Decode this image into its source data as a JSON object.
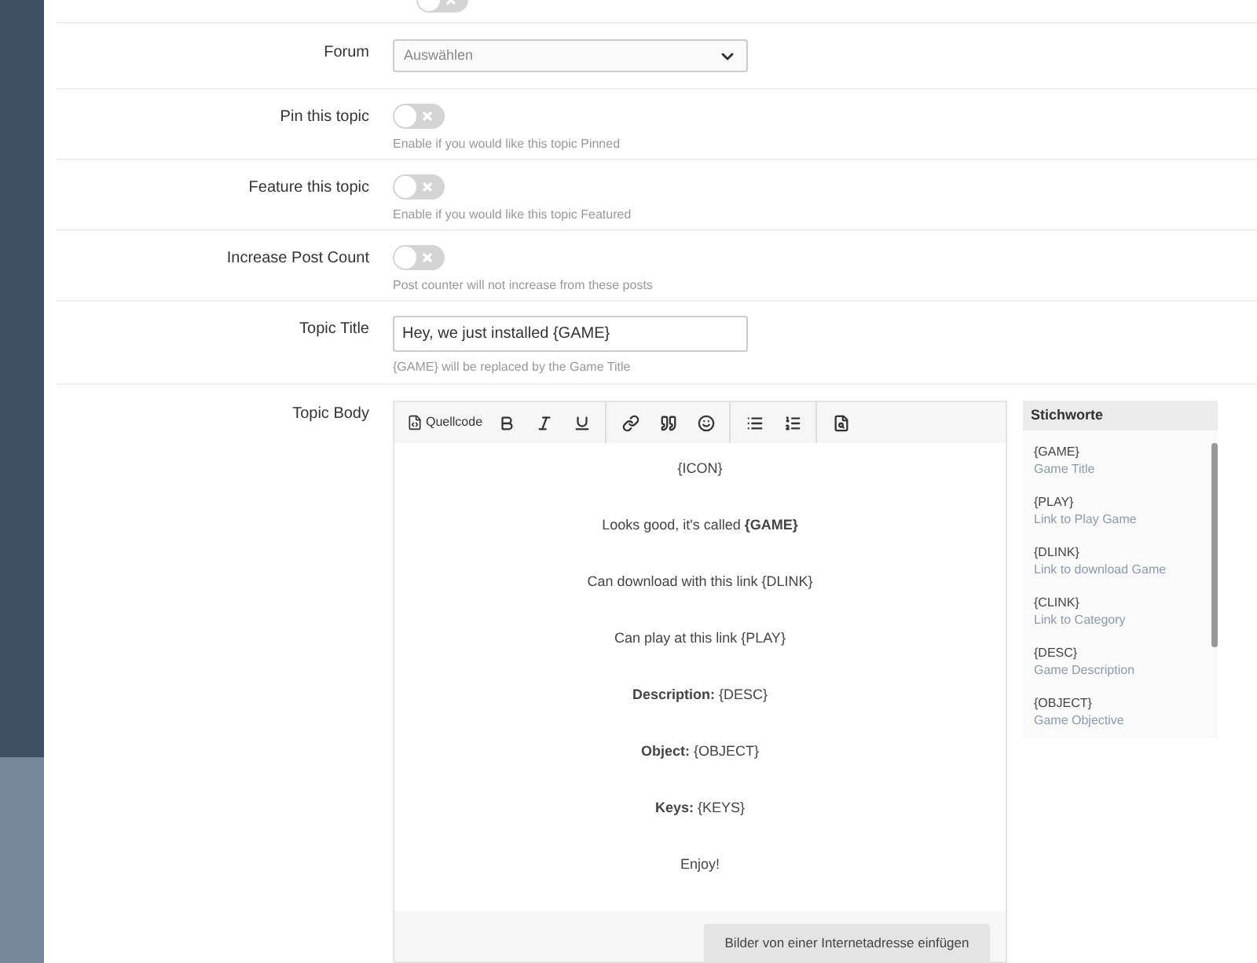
{
  "top_toggle": {
    "on": false
  },
  "rows": [
    {
      "kind": "select",
      "label": "Forum",
      "placeholder": "Auswählen"
    },
    {
      "kind": "toggle",
      "label": "Pin this topic",
      "on": false,
      "help": "Enable if you would like this topic Pinned"
    },
    {
      "kind": "toggle",
      "label": "Feature this topic",
      "on": false,
      "help": "Enable if you would like this topic Featured"
    },
    {
      "kind": "toggle",
      "label": "Increase Post Count",
      "on": false,
      "help": "Post counter will not increase from these posts"
    },
    {
      "kind": "text",
      "label": "Topic Title",
      "value": "Hey, we just installed {GAME}",
      "help": "{GAME} will be replaced by the Game Title"
    }
  ],
  "body": {
    "label": "Topic Body",
    "source_label": "Quellcode",
    "lines": [
      "{ICON}",
      "Looks good, it's called **{GAME}**",
      "Can download with this link {DLINK}",
      "Can play at this link {PLAY}",
      "**Description:** {DESC}",
      "**Object:** {OBJECT}",
      "**Keys:** {KEYS}",
      "Enjoy!"
    ],
    "footer_button": "Bilder von einer Internetadresse einfügen"
  },
  "keywords": {
    "title": "Stichworte",
    "items": [
      {
        "tag": "{GAME}",
        "desc": "Game Title"
      },
      {
        "tag": "{PLAY}",
        "desc": "Link to Play Game"
      },
      {
        "tag": "{DLINK}",
        "desc": "Link to download Game"
      },
      {
        "tag": "{CLINK}",
        "desc": "Link to Category"
      },
      {
        "tag": "{DESC}",
        "desc": "Game Description"
      },
      {
        "tag": "{OBJECT}",
        "desc": "Game Objective"
      }
    ]
  }
}
